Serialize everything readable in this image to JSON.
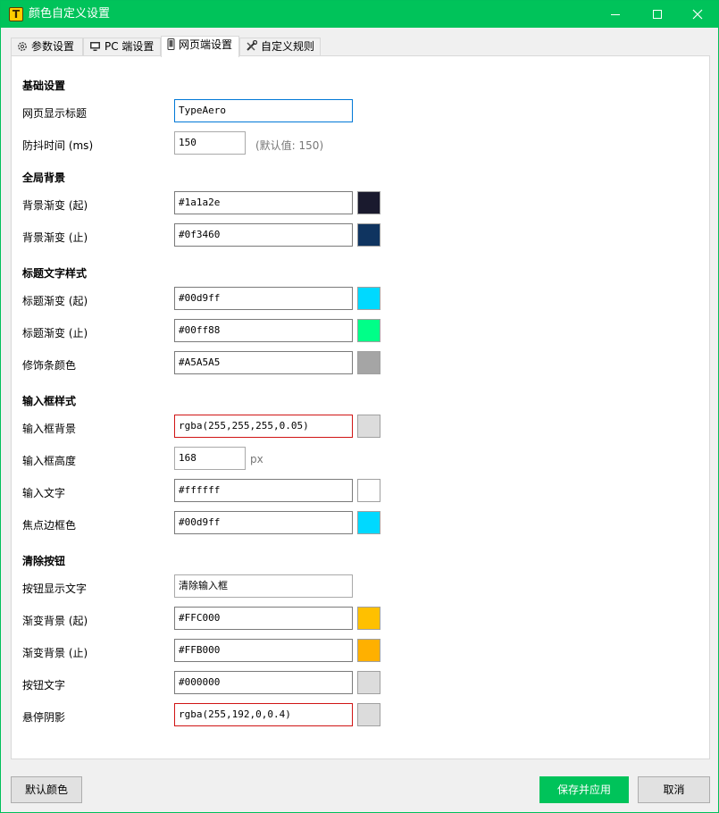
{
  "window": {
    "title": "颜色自定义设置"
  },
  "tabs": [
    {
      "label": "参数设置",
      "icon": "gear-icon"
    },
    {
      "label": "PC 端设置",
      "icon": "monitor-icon"
    },
    {
      "label": "网页端设置",
      "icon": "phone-icon"
    },
    {
      "label": "自定义规则",
      "icon": "tools-icon"
    }
  ],
  "sections": {
    "basic": "基础设置",
    "background": "全局背景",
    "title_style": "标题文字样式",
    "input_style": "输入框样式",
    "clear_button": "清除按钮"
  },
  "fields": {
    "page_title": {
      "label": "网页显示标题",
      "value": "TypeAero"
    },
    "debounce": {
      "label": "防抖时间 (ms)",
      "value": "150",
      "hint": "(默认值: 150)"
    },
    "bg_start": {
      "label": "背景渐变 (起)",
      "value": "#1a1a2e",
      "color": "#1a1a2e"
    },
    "bg_end": {
      "label": "背景渐变 (止)",
      "value": "#0f3460",
      "color": "#0f3460"
    },
    "title_start": {
      "label": "标题渐变 (起)",
      "value": "#00d9ff",
      "color": "#00d9ff"
    },
    "title_end": {
      "label": "标题渐变 (止)",
      "value": "#00ff88",
      "color": "#00ff88"
    },
    "deco_color": {
      "label": "修饰条颜色",
      "value": "#A5A5A5",
      "color": "#A5A5A5"
    },
    "input_bg": {
      "label": "输入框背景",
      "value": "rgba(255,255,255,0.05)",
      "color": "#dcdcdc"
    },
    "input_height": {
      "label": "输入框高度",
      "value": "168",
      "unit": "px"
    },
    "input_text": {
      "label": "输入文字",
      "value": "#ffffff",
      "color": "#ffffff"
    },
    "focus_border": {
      "label": "焦点边框色",
      "value": "#00d9ff",
      "color": "#00d9ff"
    },
    "btn_text_label": {
      "label": "按钮显示文字",
      "value": "清除输入框"
    },
    "btn_bg_start": {
      "label": "渐变背景 (起)",
      "value": "#FFC000",
      "color": "#FFC000"
    },
    "btn_bg_end": {
      "label": "渐变背景 (止)",
      "value": "#FFB000",
      "color": "#FFB000"
    },
    "btn_text_color": {
      "label": "按钮文字",
      "value": "#000000",
      "color": "#dcdcdc"
    },
    "hover_shadow": {
      "label": "悬停阴影",
      "value": "rgba(255,192,0,0.4)",
      "color": "#dcdcdc"
    }
  },
  "footer": {
    "default_label": "默认颜色",
    "save_label": "保存并应用",
    "cancel_label": "取消"
  },
  "colors": {
    "accent": "#00c35a",
    "error_border": "#d01414",
    "focus_border": "#0078d7"
  }
}
